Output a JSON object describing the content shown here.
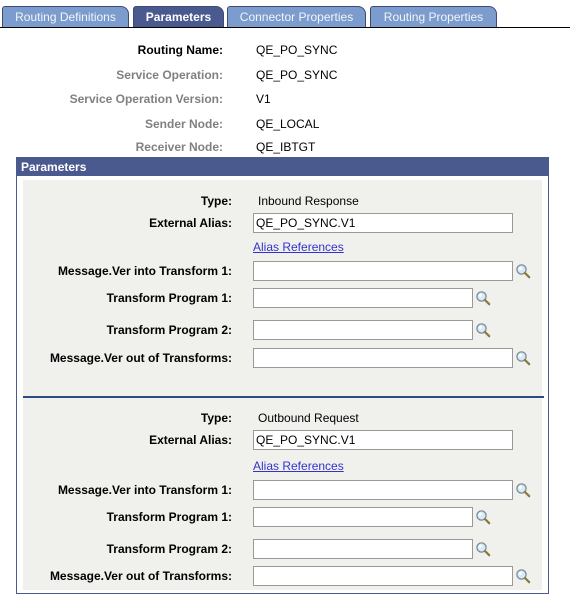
{
  "tabs": [
    {
      "label": "Routing Definitions",
      "active": false
    },
    {
      "label": "Parameters",
      "active": true
    },
    {
      "label": "Connector Properties",
      "active": false
    },
    {
      "label": "Routing Properties",
      "active": false
    }
  ],
  "header": {
    "routing_name": {
      "label": "Routing Name:",
      "value": "QE_PO_SYNC"
    },
    "service_operation": {
      "label": "Service Operation:",
      "value": "QE_PO_SYNC"
    },
    "service_operation_version": {
      "label": "Service Operation Version:",
      "value": "V1"
    },
    "sender_node": {
      "label": "Sender Node:",
      "value": "QE_LOCAL"
    },
    "receiver_node": {
      "label": "Receiver Node:",
      "value": "QE_IBTGT"
    }
  },
  "parameters": {
    "title": "Parameters",
    "sections": [
      {
        "type_label": "Type:",
        "type_value": "Inbound Response",
        "external_alias_label": "External Alias:",
        "external_alias_value": "QE_PO_SYNC.V1",
        "alias_link": "Alias References",
        "msg_into_label": "Message.Ver into Transform 1:",
        "msg_into_value": "",
        "transform1_label": "Transform Program 1:",
        "transform1_value": "",
        "transform2_label": "Transform Program 2:",
        "transform2_value": "",
        "msg_out_label": "Message.Ver out of Transforms:",
        "msg_out_value": ""
      },
      {
        "type_label": "Type:",
        "type_value": "Outbound Request",
        "external_alias_label": "External Alias:",
        "external_alias_value": "QE_PO_SYNC.V1",
        "alias_link": "Alias References",
        "msg_into_label": "Message.Ver into Transform 1:",
        "msg_into_value": "",
        "transform1_label": "Transform Program 1:",
        "transform1_value": "",
        "transform2_label": "Transform Program 2:",
        "transform2_value": "",
        "msg_out_label": "Message.Ver out of Transforms:",
        "msg_out_value": ""
      }
    ]
  },
  "icons": {
    "lookup": "magnifier-lookup-icon"
  },
  "colors": {
    "tab_inactive": "#7b9ccc",
    "tab_active": "#4a5a8e",
    "group_header": "#4a5a8e",
    "panel_bg": "#f0f1ed",
    "link": "#3333cc"
  }
}
